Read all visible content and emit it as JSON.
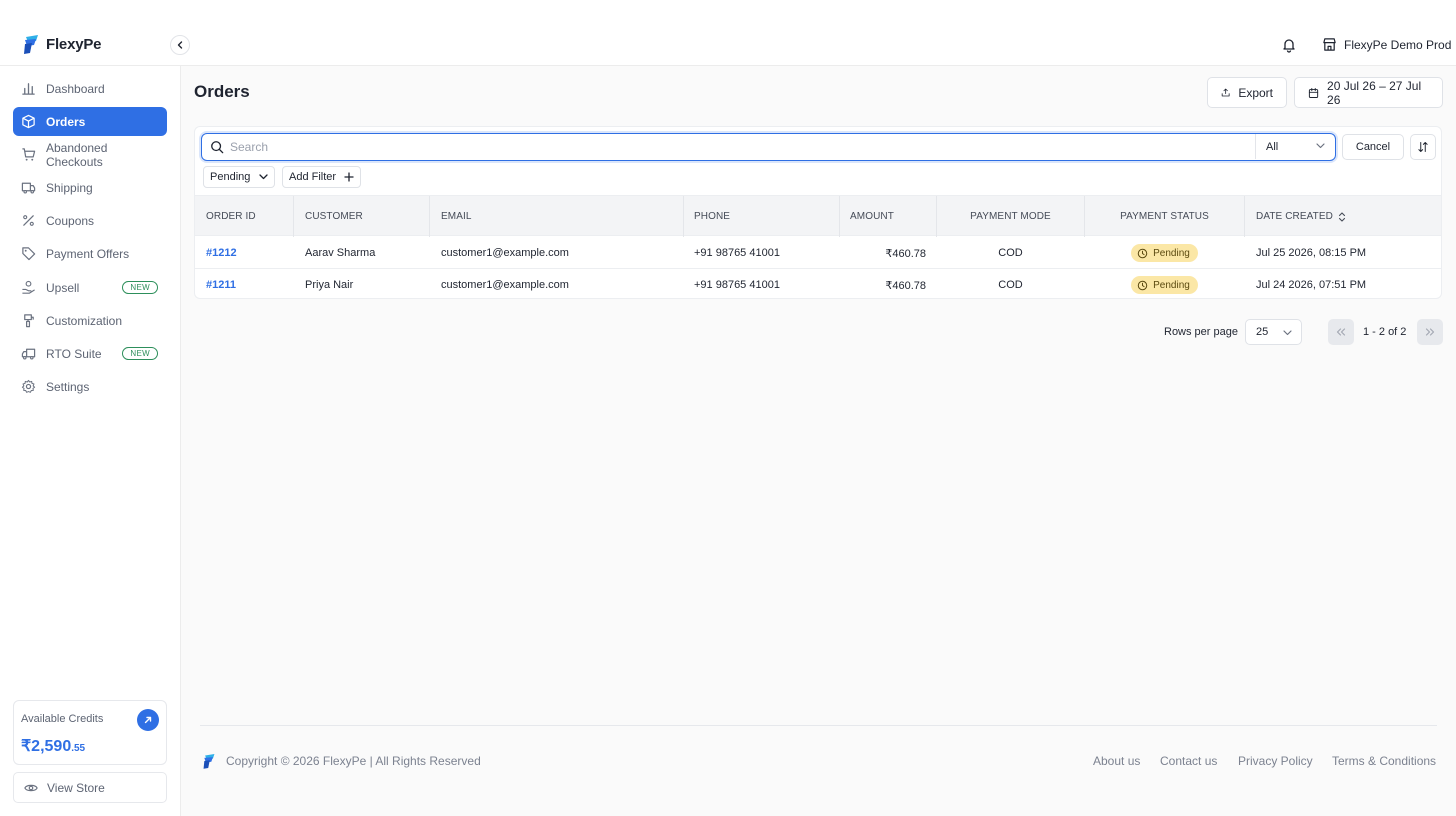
{
  "brand": {
    "name": "FlexyPe"
  },
  "header": {
    "store_name": "FlexyPe Demo Prod"
  },
  "sidebar": {
    "items": [
      {
        "label": "Dashboard"
      },
      {
        "label": "Orders"
      },
      {
        "label": "Abandoned Checkouts"
      },
      {
        "label": "Shipping"
      },
      {
        "label": "Coupons"
      },
      {
        "label": "Payment Offers"
      },
      {
        "label": "Upsell",
        "badge": "NEW"
      },
      {
        "label": "Customization"
      },
      {
        "label": "RTO Suite",
        "badge": "NEW"
      },
      {
        "label": "Settings"
      }
    ],
    "active_item": "Orders",
    "credits_label": "Available Credits",
    "credits_main": "₹2,590",
    "credits_decimal": ".55",
    "view_store": "View Store"
  },
  "page": {
    "title": "Orders",
    "export_label": "Export",
    "date_range": "20 Jul 26 – 27 Jul 26"
  },
  "search": {
    "placeholder": "Search",
    "value": "",
    "scope": "All",
    "cancel_label": "Cancel"
  },
  "filters": {
    "status_filter": "Pending",
    "add_filter_label": "Add Filter"
  },
  "table": {
    "columns": [
      "ORDER ID",
      "CUSTOMER",
      "EMAIL",
      "PHONE",
      "AMOUNT",
      "PAYMENT MODE",
      "PAYMENT STATUS",
      "DATE CREATED"
    ],
    "rows": [
      {
        "order_id": "#1212",
        "customer": "Aarav Sharma",
        "email": "customer1@example.com",
        "phone": "+91 98765 41001",
        "amount": "₹460.78",
        "payment_mode": "COD",
        "payment_status": "Pending",
        "date_created": "Jul 25 2026, 08:15 PM"
      },
      {
        "order_id": "#1211",
        "customer": "Priya Nair",
        "email": "customer1@example.com",
        "phone": "+91 98765 41001",
        "amount": "₹460.78",
        "payment_mode": "COD",
        "payment_status": "Pending",
        "date_created": "Jul 24 2026, 07:51 PM"
      }
    ]
  },
  "pagination": {
    "rows_per_page_label": "Rows per page",
    "rows_per_page": "25",
    "range": "1 - 2 of 2"
  },
  "footer": {
    "copyright": "Copyright © 2026 FlexyPe | All Rights Reserved",
    "links": [
      "About us",
      "Contact us",
      "Privacy Policy",
      "Terms & Conditions"
    ]
  },
  "colors": {
    "accent": "#2f6fe4",
    "pending_bg": "#fbe7a6",
    "new_badge": "#2d8f5b"
  },
  "icons": {
    "logo": "flexype-logo",
    "collapse": "chevron-left-icon",
    "notifications": "bell-icon",
    "store": "store-icon",
    "export": "upload-icon",
    "date": "calendar-icon",
    "search": "search-icon",
    "sort": "sort-icon"
  }
}
